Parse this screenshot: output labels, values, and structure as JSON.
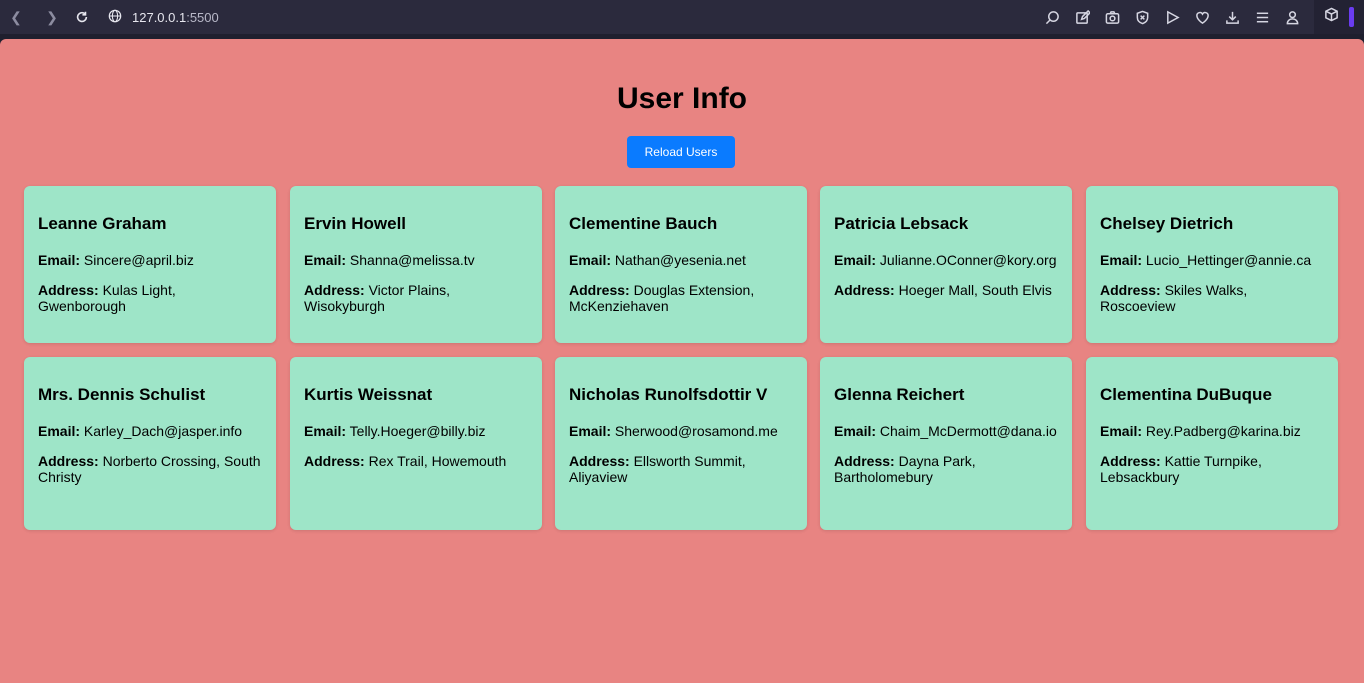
{
  "browser": {
    "url_host": "127.0.0.1",
    "url_port": ":5500"
  },
  "page": {
    "title": "User Info",
    "reload_label": "Reload Users",
    "email_label": "Email:",
    "address_label": "Address:"
  },
  "users": [
    {
      "name": "Leanne Graham",
      "email": "Sincere@april.biz",
      "address": "Kulas Light, Gwenborough"
    },
    {
      "name": "Ervin Howell",
      "email": "Shanna@melissa.tv",
      "address": "Victor Plains, Wisokyburgh"
    },
    {
      "name": "Clementine Bauch",
      "email": "Nathan@yesenia.net",
      "address": "Douglas Extension, McKenziehaven"
    },
    {
      "name": "Patricia Lebsack",
      "email": "Julianne.OConner@kory.org",
      "address": "Hoeger Mall, South Elvis"
    },
    {
      "name": "Chelsey Dietrich",
      "email": "Lucio_Hettinger@annie.ca",
      "address": "Skiles Walks, Roscoeview"
    },
    {
      "name": "Mrs. Dennis Schulist",
      "email": "Karley_Dach@jasper.info",
      "address": "Norberto Crossing, South Christy"
    },
    {
      "name": "Kurtis Weissnat",
      "email": "Telly.Hoeger@billy.biz",
      "address": "Rex Trail, Howemouth"
    },
    {
      "name": "Nicholas Runolfsdottir V",
      "email": "Sherwood@rosamond.me",
      "address": "Ellsworth Summit, Aliyaview"
    },
    {
      "name": "Glenna Reichert",
      "email": "Chaim_McDermott@dana.io",
      "address": "Dayna Park, Bartholomebury"
    },
    {
      "name": "Clementina DuBuque",
      "email": "Rey.Padberg@karina.biz",
      "address": "Kattie Turnpike, Lebsackbury"
    }
  ],
  "colors": {
    "background": "#e88482",
    "card": "#9ee5c8",
    "button": "#0a7bff"
  }
}
